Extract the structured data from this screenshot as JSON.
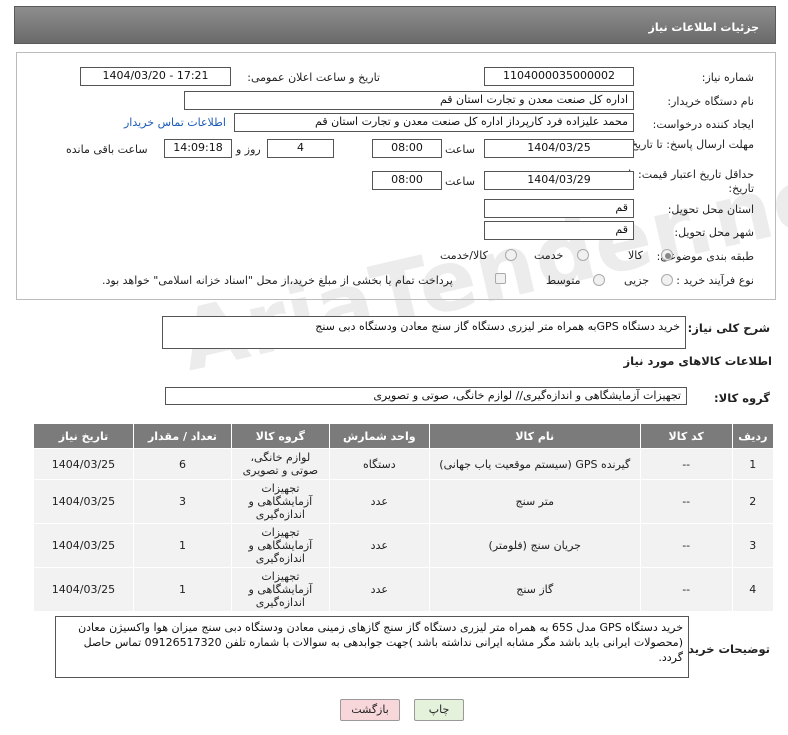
{
  "header": {
    "title": "جزئیات اطلاعات نیاز"
  },
  "form": {
    "need_number_label": "شماره نیاز:",
    "need_number": "1104000035000002",
    "announce_label": "تاریخ و ساعت اعلان عمومی:",
    "announce_value": "1404/03/20 - 17:21",
    "buyer_label": "نام دستگاه خریدار:",
    "buyer_value": "اداره کل صنعت  معدن و تجارت استان قم",
    "creator_label": "ایجاد کننده درخواست:",
    "creator_value": "محمد  علیزاده فرد کارپرداز اداره کل صنعت  معدن و تجارت استان قم",
    "contact_link": "اطلاعات تماس خریدار",
    "deadline_label": "مهلت ارسال پاسخ: تا تاریخ:",
    "deadline_date": "1404/03/25",
    "time_label": "ساعت",
    "deadline_time": "08:00",
    "days_value": "4",
    "days_label": "روز و",
    "remaining_time": "14:09:18",
    "remaining_label": "ساعت باقی مانده",
    "min_price_label": "حداقل تاریخ اعتبار قیمت: تا تاریخ:",
    "min_price_date": "1404/03/29",
    "min_price_time": "08:00",
    "province_label": "استان محل تحویل:",
    "province_value": "قم",
    "city_label": "شهر محل تحویل:",
    "city_value": "قم",
    "category_label": "طبقه بندی موضوعی:",
    "category_options": [
      "کالا",
      "خدمت",
      "کالا/خدمت"
    ],
    "category_selected": "کالا",
    "purchase_type_label": "نوع فرآیند خرید :",
    "purchase_options": [
      "جزیی",
      "متوسط"
    ],
    "payment_note": "پرداخت تمام یا بخشی از مبلغ خرید،از محل \"اسناد خزانه اسلامی\" خواهد بود."
  },
  "summary": {
    "label": "شرح کلی نیاز:",
    "value": "خرید دستگاه GPSبه همراه متر لیزری دستگاه گاز سنج معادن ودستگاه دبی سنج"
  },
  "goods": {
    "section_title": "اطلاعات کالاهای مورد نیاز",
    "group_label": "گروه کالا:",
    "group_value": "تجهیزات آزمایشگاهی و اندازه‌گیری// لوازم خانگی، صوتی و تصویری",
    "columns": [
      "ردیف",
      "کد کالا",
      "نام کالا",
      "واحد شمارش",
      "گروه کالا",
      "تعداد / مقدار",
      "تاریخ نیاز"
    ],
    "rows": [
      [
        "1",
        "--",
        "گیرنده GPS (سیستم موقعیت یاب جهانی)",
        "دستگاه",
        "لوازم خانگی، صوتی و تصویری",
        "6",
        "1404/03/25"
      ],
      [
        "2",
        "--",
        "متر سنج",
        "عدد",
        "تجهیزات آزمایشگاهی و اندازه‌گیری",
        "3",
        "1404/03/25"
      ],
      [
        "3",
        "--",
        "جریان سنج (فلومتر)",
        "عدد",
        "تجهیزات آزمایشگاهی و اندازه‌گیری",
        "1",
        "1404/03/25"
      ],
      [
        "4",
        "--",
        "گاز سنج",
        "عدد",
        "تجهیزات آزمایشگاهی و اندازه‌گیری",
        "1",
        "1404/03/25"
      ]
    ]
  },
  "notes": {
    "label": "توضیحات خریدار:",
    "value": "خرید دستگاه  GPS  مدل 65S به همراه متر لیزری دستگاه گاز سنج گازهای زمینی معادن ودستگاه دبی سنج  میزان هوا واکسیژن معادن (محصولات ایرانی باید باشد مگر مشابه ایرانی نداشته باشد )جهت جوابدهی به سوالات با شماره تلفن 09126517320 تماس حاصل گردد."
  },
  "buttons": {
    "print": "چاپ",
    "back": "بازگشت"
  },
  "watermark": "AriaTender.net",
  "colors": {
    "header": "#7b7b7b",
    "link": "#1a5bb8",
    "back_button": "#f8d7da",
    "print_button": "#e4f2dc"
  }
}
